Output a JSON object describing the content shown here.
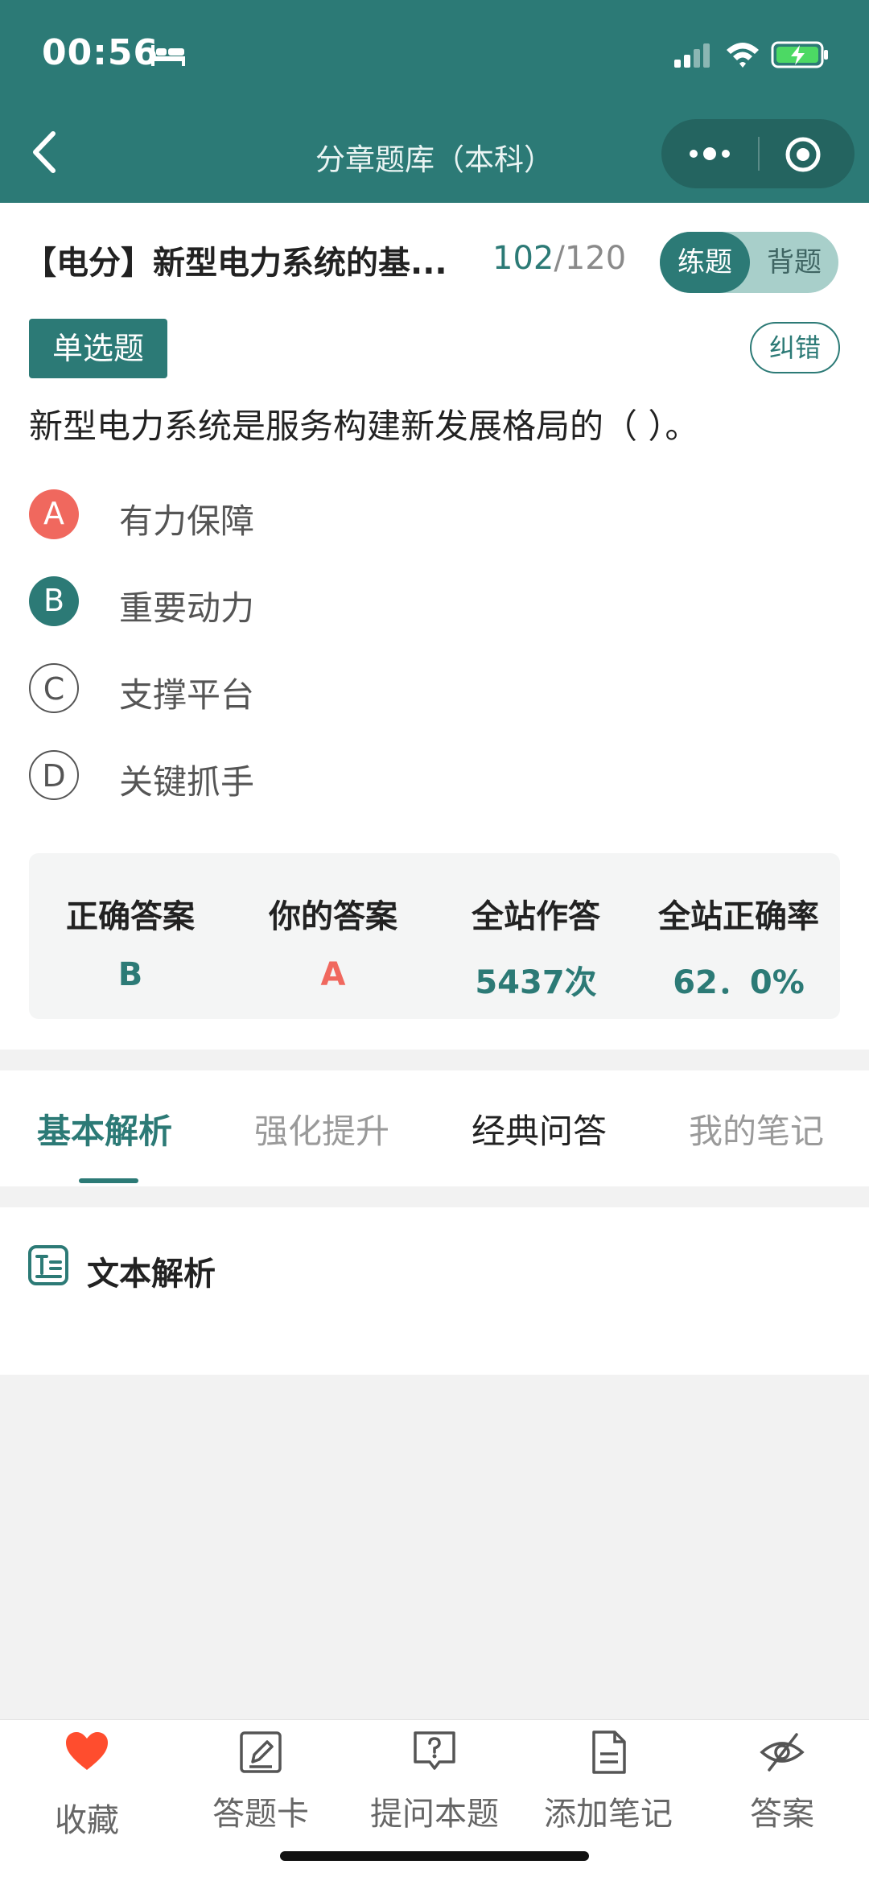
{
  "status_bar": {
    "time": "00:56"
  },
  "nav": {
    "title": "分章题库（本科）"
  },
  "question": {
    "chapter": "【电分】新型电力系统的基...",
    "progress_current": "102",
    "progress_sep_total": "/120",
    "mode_practice": "练题",
    "mode_memorize": "背题",
    "type": "单选题",
    "report_label": "纠错",
    "stem": "新型电力系统是服务构建新发展格局的（ ）。",
    "options": [
      {
        "key": "A",
        "text": "有力保障",
        "state": "wrong"
      },
      {
        "key": "B",
        "text": "重要动力",
        "state": "correct"
      },
      {
        "key": "C",
        "text": "支撑平台",
        "state": "plain"
      },
      {
        "key": "D",
        "text": "关键抓手",
        "state": "plain"
      }
    ]
  },
  "stats": [
    {
      "label": "正确答案",
      "value": "B",
      "color": "#2c7a76"
    },
    {
      "label": "你的答案",
      "value": "A",
      "color": "#f0685e"
    },
    {
      "label": "全站作答",
      "value": "5437次",
      "color": "#2c7a76"
    },
    {
      "label": "全站正确率",
      "value": "62．0%",
      "color": "#2c7a76"
    }
  ],
  "tabs": [
    "基本解析",
    "强化提升",
    "经典问答",
    "我的笔记"
  ],
  "analysis": {
    "title": "文本解析"
  },
  "bottom_bar": [
    {
      "label": "收藏",
      "icon": "heart-icon"
    },
    {
      "label": "答题卡",
      "icon": "edit-icon"
    },
    {
      "label": "提问本题",
      "icon": "question-bubble-icon"
    },
    {
      "label": "添加笔记",
      "icon": "note-icon"
    },
    {
      "label": "答案",
      "icon": "eye-slash-icon"
    }
  ],
  "colors": {
    "primary": "#2c7a76",
    "wrong": "#f0685e",
    "favorite": "#ff4d2e"
  }
}
